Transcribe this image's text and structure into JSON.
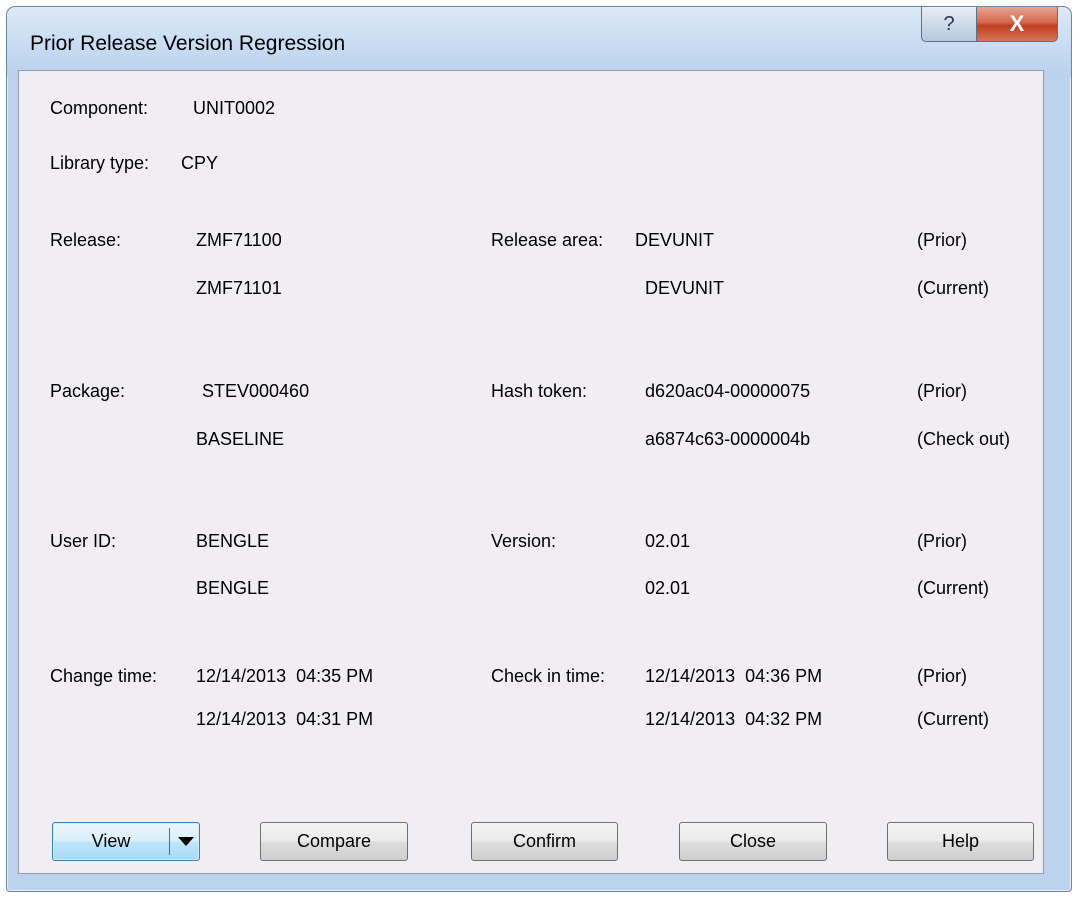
{
  "window": {
    "title": "Prior Release Version Regression",
    "help_glyph": "?",
    "close_glyph": "X"
  },
  "fields": {
    "component_label": "Component:",
    "component_value": "UNIT0002",
    "library_type_label": "Library type:",
    "library_type_value": "CPY",
    "release_label": "Release:",
    "release_prior": "ZMF71100",
    "release_current": "ZMF71101",
    "release_area_label": "Release area:",
    "release_area_prior": "DEVUNIT",
    "release_area_current": "DEVUNIT",
    "package_label": "Package:",
    "package_prior": "STEV000460",
    "package_current": "BASELINE",
    "hash_token_label": "Hash token:",
    "hash_token_prior": "d620ac04-00000075",
    "hash_token_current": "a6874c63-0000004b",
    "user_id_label": "User ID:",
    "user_id_prior": "BENGLE",
    "user_id_current": "BENGLE",
    "version_label": "Version:",
    "version_prior": "02.01",
    "version_current": "02.01",
    "change_time_label": "Change time:",
    "change_time_prior": "12/14/2013  04:35 PM",
    "change_time_current": "12/14/2013  04:31 PM",
    "check_in_time_label": "Check in time:",
    "check_in_time_prior": "12/14/2013  04:36 PM",
    "check_in_time_current": "12/14/2013  04:32 PM"
  },
  "tags": {
    "prior": "(Prior)",
    "current": "(Current)",
    "check_out": "(Check out)"
  },
  "buttons": {
    "view": "View",
    "compare": "Compare",
    "confirm": "Confirm",
    "close": "Close",
    "help": "Help"
  },
  "colors": {
    "frame": "#bcd3ee",
    "client_background": "#f1eef3",
    "close_button_red": "#c23e1f",
    "view_button_blue": "#bee6fd"
  },
  "icons": {
    "help": "question-mark-icon",
    "close": "close-icon",
    "dropdown": "dropdown-arrow-icon"
  }
}
